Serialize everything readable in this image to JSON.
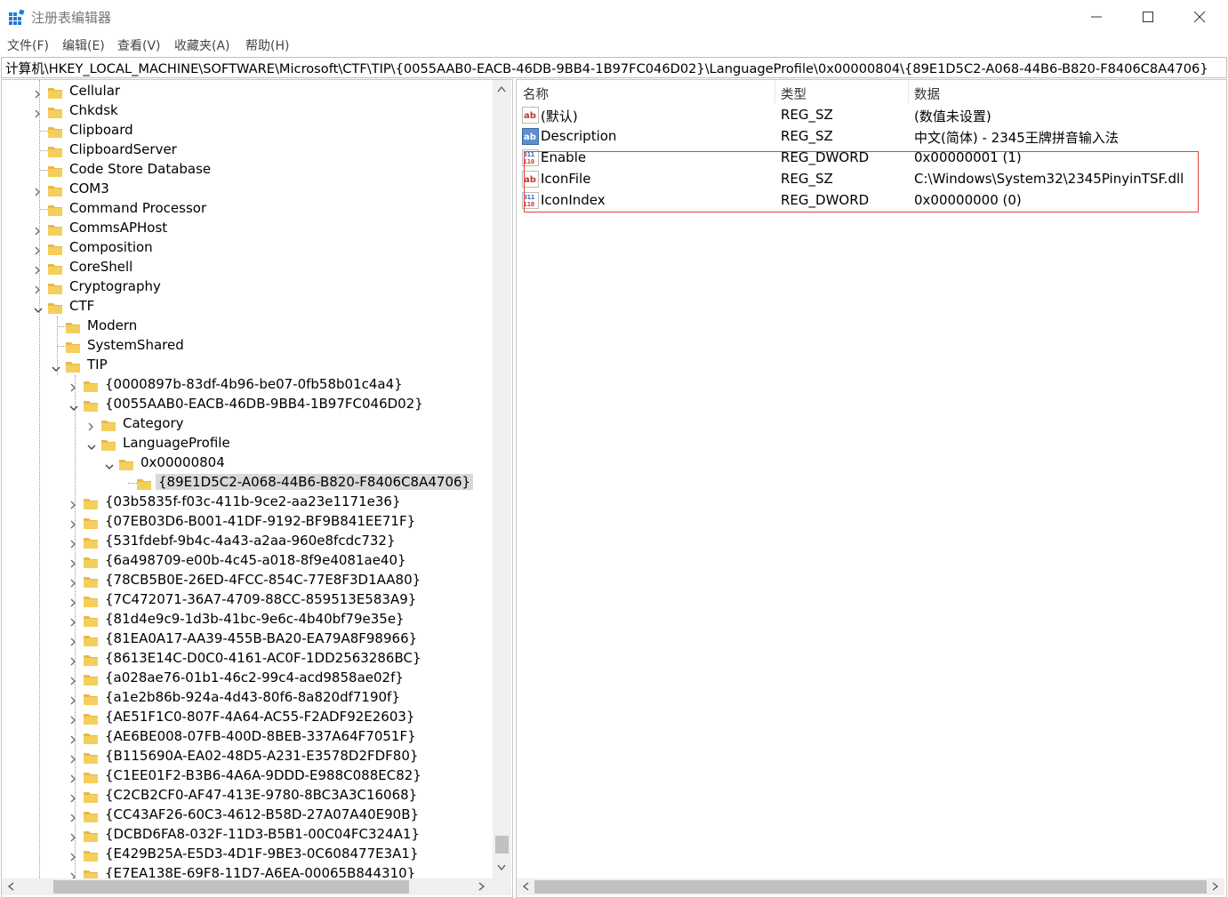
{
  "window": {
    "title": "注册表编辑器",
    "controls": [
      "minimize",
      "maximize",
      "close"
    ]
  },
  "menu": [
    "文件(F)",
    "编辑(E)",
    "查看(V)",
    "收藏夹(A)",
    "帮助(H)"
  ],
  "address": "计算机\\HKEY_LOCAL_MACHINE\\SOFTWARE\\Microsoft\\CTF\\TIP\\{0055AAB0-EACB-46DB-9BB4-1B97FC046D02}\\LanguageProfile\\0x00000804\\{89E1D5C2-A068-44B6-B820-F8406C8A4706}",
  "tree": [
    {
      "label": "Cellular",
      "level": 0,
      "state": "collapsed"
    },
    {
      "label": "Chkdsk",
      "level": 0,
      "state": "collapsed"
    },
    {
      "label": "Clipboard",
      "level": 0,
      "state": "none"
    },
    {
      "label": "ClipboardServer",
      "level": 0,
      "state": "none"
    },
    {
      "label": "Code Store Database",
      "level": 0,
      "state": "none"
    },
    {
      "label": "COM3",
      "level": 0,
      "state": "collapsed"
    },
    {
      "label": "Command Processor",
      "level": 0,
      "state": "none"
    },
    {
      "label": "CommsAPHost",
      "level": 0,
      "state": "collapsed"
    },
    {
      "label": "Composition",
      "level": 0,
      "state": "collapsed"
    },
    {
      "label": "CoreShell",
      "level": 0,
      "state": "collapsed"
    },
    {
      "label": "Cryptography",
      "level": 0,
      "state": "collapsed"
    },
    {
      "label": "CTF",
      "level": 0,
      "state": "expanded"
    },
    {
      "label": "Modern",
      "level": 1,
      "state": "none"
    },
    {
      "label": "SystemShared",
      "level": 1,
      "state": "none"
    },
    {
      "label": "TIP",
      "level": 1,
      "state": "expanded"
    },
    {
      "label": "{0000897b-83df-4b96-be07-0fb58b01c4a4}",
      "level": 2,
      "state": "collapsed"
    },
    {
      "label": "{0055AAB0-EACB-46DB-9BB4-1B97FC046D02}",
      "level": 2,
      "state": "expanded"
    },
    {
      "label": "Category",
      "level": 3,
      "state": "collapsed"
    },
    {
      "label": "LanguageProfile",
      "level": 3,
      "state": "expanded"
    },
    {
      "label": "0x00000804",
      "level": 4,
      "state": "expanded"
    },
    {
      "label": "{89E1D5C2-A068-44B6-B820-F8406C8A4706}",
      "level": 5,
      "state": "none",
      "selected": true
    },
    {
      "label": "{03b5835f-f03c-411b-9ce2-aa23e1171e36}",
      "level": 2,
      "state": "collapsed"
    },
    {
      "label": "{07EB03D6-B001-41DF-9192-BF9B841EE71F}",
      "level": 2,
      "state": "collapsed"
    },
    {
      "label": "{531fdebf-9b4c-4a43-a2aa-960e8fcdc732}",
      "level": 2,
      "state": "collapsed"
    },
    {
      "label": "{6a498709-e00b-4c45-a018-8f9e4081ae40}",
      "level": 2,
      "state": "collapsed"
    },
    {
      "label": "{78CB5B0E-26ED-4FCC-854C-77E8F3D1AA80}",
      "level": 2,
      "state": "collapsed"
    },
    {
      "label": "{7C472071-36A7-4709-88CC-859513E583A9}",
      "level": 2,
      "state": "collapsed"
    },
    {
      "label": "{81d4e9c9-1d3b-41bc-9e6c-4b40bf79e35e}",
      "level": 2,
      "state": "collapsed"
    },
    {
      "label": "{81EA0A17-AA39-455B-BA20-EA79A8F98966}",
      "level": 2,
      "state": "collapsed"
    },
    {
      "label": "{8613E14C-D0C0-4161-AC0F-1DD2563286BC}",
      "level": 2,
      "state": "collapsed"
    },
    {
      "label": "{a028ae76-01b1-46c2-99c4-acd9858ae02f}",
      "level": 2,
      "state": "collapsed"
    },
    {
      "label": "{a1e2b86b-924a-4d43-80f6-8a820df7190f}",
      "level": 2,
      "state": "collapsed"
    },
    {
      "label": "{AE51F1C0-807F-4A64-AC55-F2ADF92E2603}",
      "level": 2,
      "state": "collapsed"
    },
    {
      "label": "{AE6BE008-07FB-400D-8BEB-337A64F7051F}",
      "level": 2,
      "state": "collapsed"
    },
    {
      "label": "{B115690A-EA02-48D5-A231-E3578D2FDF80}",
      "level": 2,
      "state": "collapsed"
    },
    {
      "label": "{C1EE01F2-B3B6-4A6A-9DDD-E988C088EC82}",
      "level": 2,
      "state": "collapsed"
    },
    {
      "label": "{C2CB2CF0-AF47-413E-9780-8BC3A3C16068}",
      "level": 2,
      "state": "collapsed"
    },
    {
      "label": "{CC43AF26-60C3-4612-B58D-27A07A40E90B}",
      "level": 2,
      "state": "collapsed"
    },
    {
      "label": "{DCBD6FA8-032F-11D3-B5B1-00C04FC324A1}",
      "level": 2,
      "state": "collapsed"
    },
    {
      "label": "{E429B25A-E5D3-4D1F-9BE3-0C608477E3A1}",
      "level": 2,
      "state": "collapsed"
    },
    {
      "label": "{E7EA138E-69F8-11D7-A6EA-00065B844310}",
      "level": 2,
      "state": "collapsed"
    }
  ],
  "columns": [
    "名称",
    "类型",
    "数据"
  ],
  "values": [
    {
      "name": "(默认)",
      "type": "REG_SZ",
      "data": "(数值未设置)",
      "icon": "string-value-icon"
    },
    {
      "name": "Description",
      "type": "REG_SZ",
      "data": "中文(简体) - 2345王牌拼音输入法",
      "icon": "binary-string-icon"
    },
    {
      "name": "Enable",
      "type": "REG_DWORD",
      "data": "0x00000001 (1)",
      "icon": "dword-value-icon"
    },
    {
      "name": "IconFile",
      "type": "REG_SZ",
      "data": "C:\\Windows\\System32\\2345PinyinTSF.dll",
      "icon": "string-value-icon"
    },
    {
      "name": "IconIndex",
      "type": "REG_DWORD",
      "data": "0x00000000 (0)",
      "icon": "dword-value-icon"
    }
  ],
  "colors": {
    "highlight_box": "#e0403c",
    "folder": "#f0c040",
    "selection": "#d9d9d9"
  }
}
